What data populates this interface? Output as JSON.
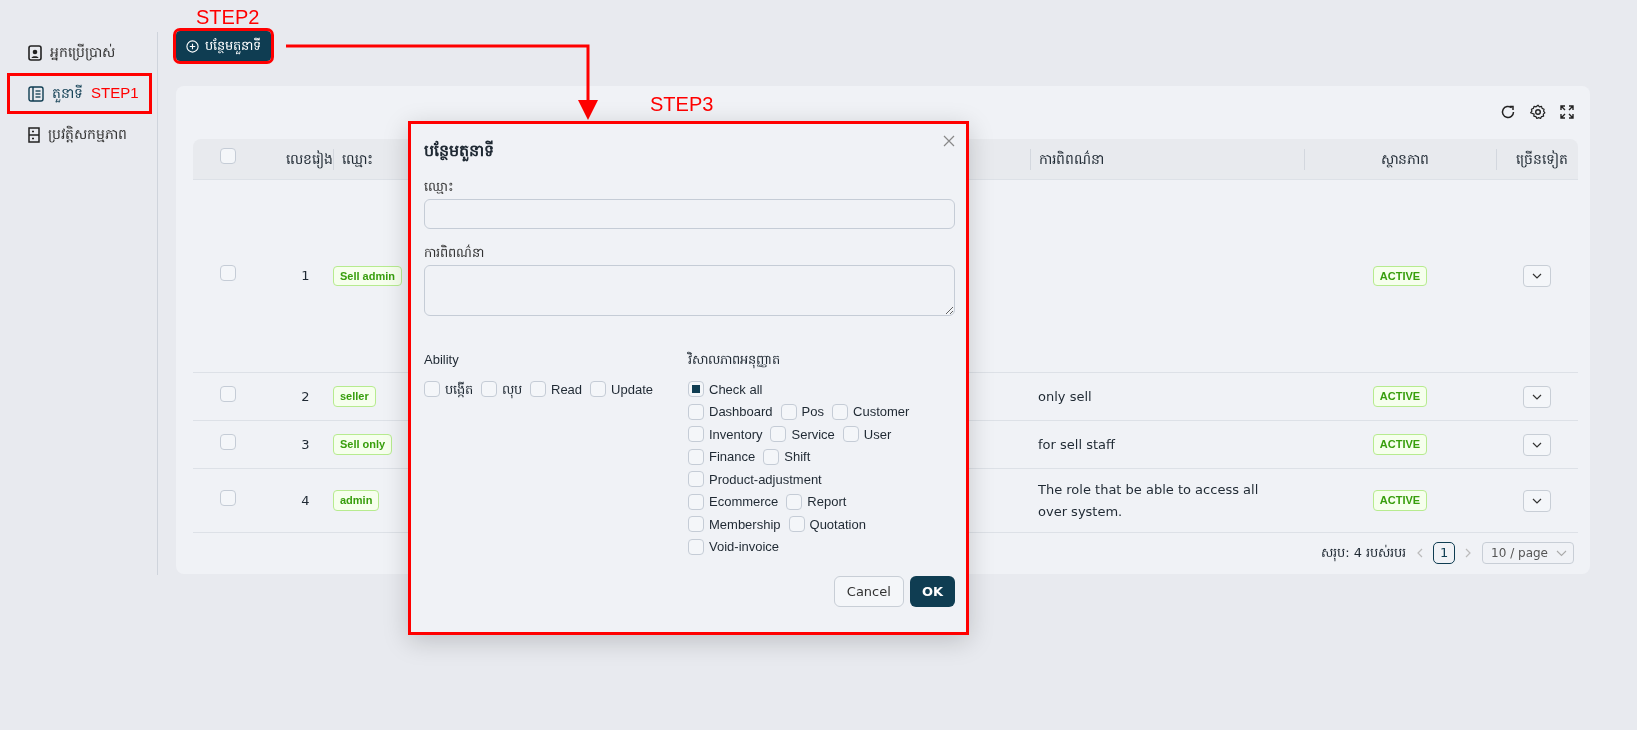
{
  "sidebar": {
    "items": [
      {
        "label": "អ្នកប្រើប្រាស់",
        "selected": false
      },
      {
        "label": "តួនាទី",
        "selected": true,
        "annotation": "STEP1"
      },
      {
        "label": "ប្រវត្តិសកម្មភាព",
        "selected": false
      }
    ]
  },
  "add_button": {
    "label": "បន្ថែមតួនាទី",
    "annotation": "STEP2"
  },
  "table": {
    "header_checkbox": {
      "checked": false
    },
    "columns": [
      "លេខរៀង",
      "ឈ្មោះ",
      "ការពិពណ៌នា",
      "ស្ថានភាព",
      "ច្រើនទៀត"
    ],
    "rows": [
      {
        "number": "1",
        "name": "Sell admin",
        "status": "ACTIVE",
        "selected": false
      },
      {
        "number": "2",
        "name": "seller",
        "description": "only sell",
        "status": "ACTIVE",
        "selected": false
      },
      {
        "number": "3",
        "name": "Sell only",
        "description": "for sell staff",
        "status": "ACTIVE",
        "selected": false
      },
      {
        "number": "4",
        "name": "admin",
        "description": "The role that be able to access all over system.",
        "status": "ACTIVE",
        "selected": false
      }
    ]
  },
  "pagination": {
    "total": "សរុប: 4 របស់របរ",
    "pages": [
      {
        "label": "1",
        "selected": true
      }
    ],
    "page_size": "10 / page"
  },
  "modal": {
    "annotation": "STEP3",
    "title": "បន្ថែមតួនាទី",
    "fields": [
      {
        "label": "ឈ្មោះ",
        "kind": "input"
      },
      {
        "label": "ការពិពណ៌នា",
        "kind": "textarea"
      }
    ],
    "ability": {
      "label": "Ability",
      "options": [
        {
          "label": "បង្កើត",
          "checked": false
        },
        {
          "label": "លុប",
          "checked": false
        },
        {
          "label": "Read",
          "checked": false
        },
        {
          "label": "Update",
          "checked": false
        }
      ]
    },
    "permissions": {
      "label": "វិសាលភាពអនុញ្ញាត",
      "rows": [
        [
          {
            "label": "Check all",
            "checked": false,
            "indeterminate": true
          }
        ],
        [
          {
            "label": "Dashboard",
            "checked": false
          },
          {
            "label": "Pos",
            "checked": false
          },
          {
            "label": "Customer",
            "checked": false
          }
        ],
        [
          {
            "label": "Inventory",
            "checked": false
          },
          {
            "label": "Service",
            "checked": false
          },
          {
            "label": "User",
            "checked": false
          }
        ],
        [
          {
            "label": "Finance",
            "checked": false
          },
          {
            "label": "Shift",
            "checked": false
          }
        ],
        [
          {
            "label": "Product-adjustment",
            "checked": false
          }
        ],
        [
          {
            "label": "Ecommerce",
            "checked": false
          },
          {
            "label": "Report",
            "checked": false
          }
        ],
        [
          {
            "label": "Membership",
            "checked": false
          },
          {
            "label": "Quotation",
            "checked": false
          }
        ],
        [
          {
            "label": "Void-invoice",
            "checked": false
          }
        ]
      ]
    },
    "buttons": [
      {
        "label": "Cancel",
        "kind": "default"
      },
      {
        "label": "OK",
        "kind": "primary"
      }
    ]
  }
}
